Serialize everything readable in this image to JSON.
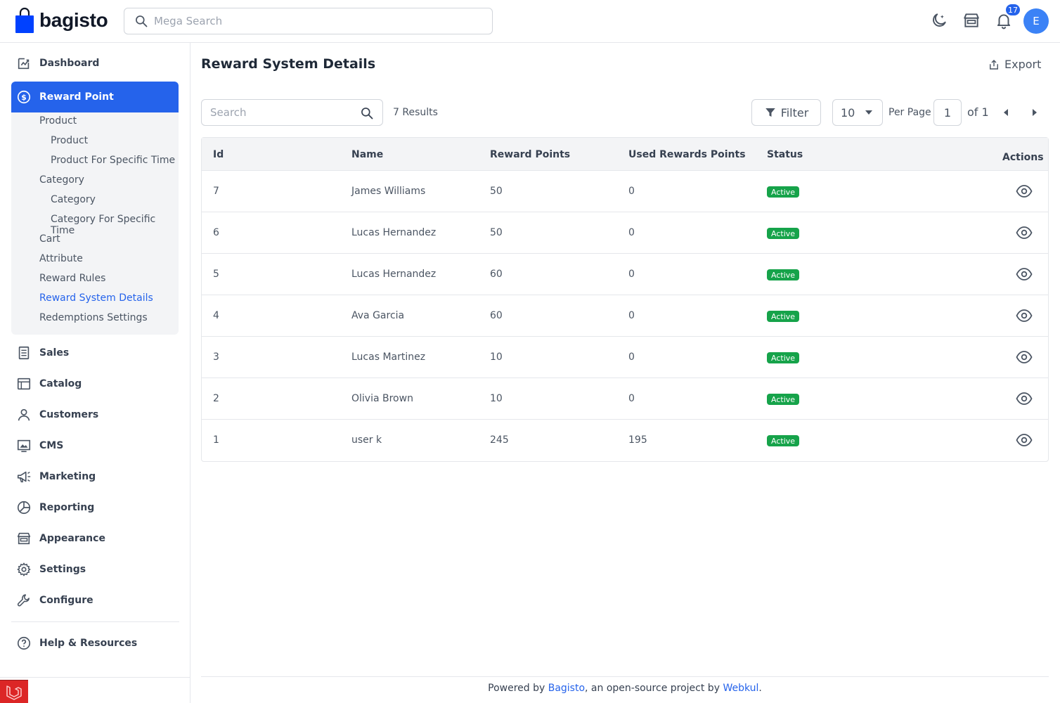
{
  "header": {
    "logo_text": "bagisto",
    "search_placeholder": "Mega Search",
    "notification_count": "17",
    "avatar_initial": "E"
  },
  "sidebar": {
    "items": [
      {
        "label": "Dashboard",
        "icon": "dashboard-icon"
      },
      {
        "label": "Reward Point",
        "icon": "dollar-circle-icon"
      },
      {
        "label": "Sales",
        "icon": "sales-icon"
      },
      {
        "label": "Catalog",
        "icon": "catalog-icon"
      },
      {
        "label": "Customers",
        "icon": "customers-icon"
      },
      {
        "label": "CMS",
        "icon": "cms-icon"
      },
      {
        "label": "Marketing",
        "icon": "megaphone-icon"
      },
      {
        "label": "Reporting",
        "icon": "pie-chart-icon"
      },
      {
        "label": "Appearance",
        "icon": "store-icon"
      },
      {
        "label": "Settings",
        "icon": "gear-icon"
      },
      {
        "label": "Configure",
        "icon": "wrench-icon"
      }
    ],
    "help_label": "Help & Resources",
    "reward_submenu": [
      {
        "label": "Product",
        "level": 1
      },
      {
        "label": "Product",
        "level": 2
      },
      {
        "label": "Product For Specific Time",
        "level": 2
      },
      {
        "label": "Category",
        "level": 1
      },
      {
        "label": "Category",
        "level": 2
      },
      {
        "label": "Category For Specific Time",
        "level": 2
      },
      {
        "label": "Cart",
        "level": 1
      },
      {
        "label": "Attribute",
        "level": 1
      },
      {
        "label": "Reward Rules",
        "level": 1
      },
      {
        "label": "Reward System Details",
        "level": 1,
        "current": true
      },
      {
        "label": "Redemptions Settings",
        "level": 1
      }
    ]
  },
  "main": {
    "title": "Reward System Details",
    "export_label": "Export",
    "search_placeholder": "Search",
    "results": "7 Results",
    "filter_label": "Filter",
    "per_page_value": "10",
    "per_page_label": "Per Page",
    "page_value": "1",
    "page_of": "of 1"
  },
  "table": {
    "columns": [
      "Id",
      "Name",
      "Reward Points",
      "Used Rewards Points",
      "Status",
      "Actions"
    ],
    "rows": [
      {
        "id": "7",
        "name": "James Williams",
        "reward_points": "50",
        "used_points": "0",
        "status": "Active"
      },
      {
        "id": "6",
        "name": "Lucas Hernandez",
        "reward_points": "50",
        "used_points": "0",
        "status": "Active"
      },
      {
        "id": "5",
        "name": "Lucas Hernandez",
        "reward_points": "60",
        "used_points": "0",
        "status": "Active"
      },
      {
        "id": "4",
        "name": "Ava Garcia",
        "reward_points": "60",
        "used_points": "0",
        "status": "Active"
      },
      {
        "id": "3",
        "name": "Lucas Martinez",
        "reward_points": "10",
        "used_points": "0",
        "status": "Active"
      },
      {
        "id": "2",
        "name": "Olivia Brown",
        "reward_points": "10",
        "used_points": "0",
        "status": "Active"
      },
      {
        "id": "1",
        "name": "user k",
        "reward_points": "245",
        "used_points": "195",
        "status": "Active"
      }
    ]
  },
  "footer": {
    "prefix": "Powered by ",
    "link1": "Bagisto",
    "middle": ", an open-source project by ",
    "link2": "Webkul",
    "suffix": "."
  },
  "colors": {
    "accent": "#2563eb",
    "status_active": "#16a34a",
    "logo_bag": "#0041ff"
  }
}
